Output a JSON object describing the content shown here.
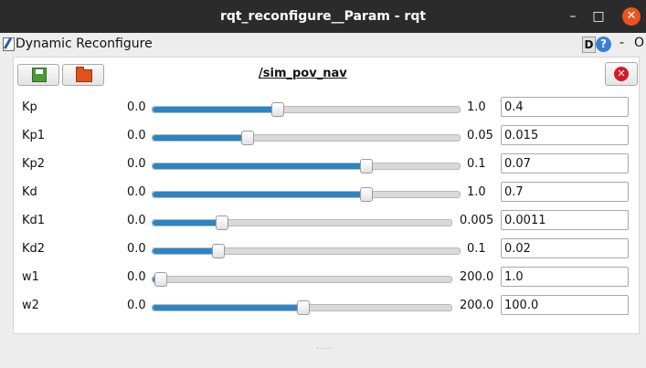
{
  "window": {
    "title": "rqt_reconfigure__Param - rqt",
    "min_glyph": "–",
    "max_glyph": "□",
    "close_glyph": "✕"
  },
  "plugin": {
    "title": "Dynamic Reconfigure",
    "d_label": "D",
    "help_label": "?",
    "minus_label": "-",
    "o_label": "O"
  },
  "toolbar": {
    "save_icon": "save-icon",
    "open_icon": "open-folder-icon",
    "node_name": "/sim_pov_nav",
    "close_glyph": "✕"
  },
  "params": [
    {
      "name": "Kp",
      "min": "0.0",
      "max": "1.0",
      "value": "0.4",
      "fraction": 0.4
    },
    {
      "name": "Kp1",
      "min": "0.0",
      "max": "0.05",
      "value": "0.015",
      "fraction": 0.3
    },
    {
      "name": "Kp2",
      "min": "0.0",
      "max": "0.1",
      "value": "0.07",
      "fraction": 0.7
    },
    {
      "name": "Kd",
      "min": "0.0",
      "max": "1.0",
      "value": "0.7",
      "fraction": 0.7
    },
    {
      "name": "Kd1",
      "min": "0.0",
      "max": "0.005",
      "value": "0.0011",
      "fraction": 0.22
    },
    {
      "name": "Kd2",
      "min": "0.0",
      "max": "0.1",
      "value": "0.02",
      "fraction": 0.2
    },
    {
      "name": "w1",
      "min": "0.0",
      "max": "200.0",
      "value": "1.0",
      "fraction": 0.005
    },
    {
      "name": "w2",
      "min": "0.0",
      "max": "200.0",
      "value": "100.0",
      "fraction": 0.5
    }
  ],
  "colors": {
    "titlebar": "#2b2b2b",
    "slider_fill": "#2a85c8",
    "close_button": "#e95420",
    "node_close": "#d51a2a"
  },
  "grip": "....."
}
